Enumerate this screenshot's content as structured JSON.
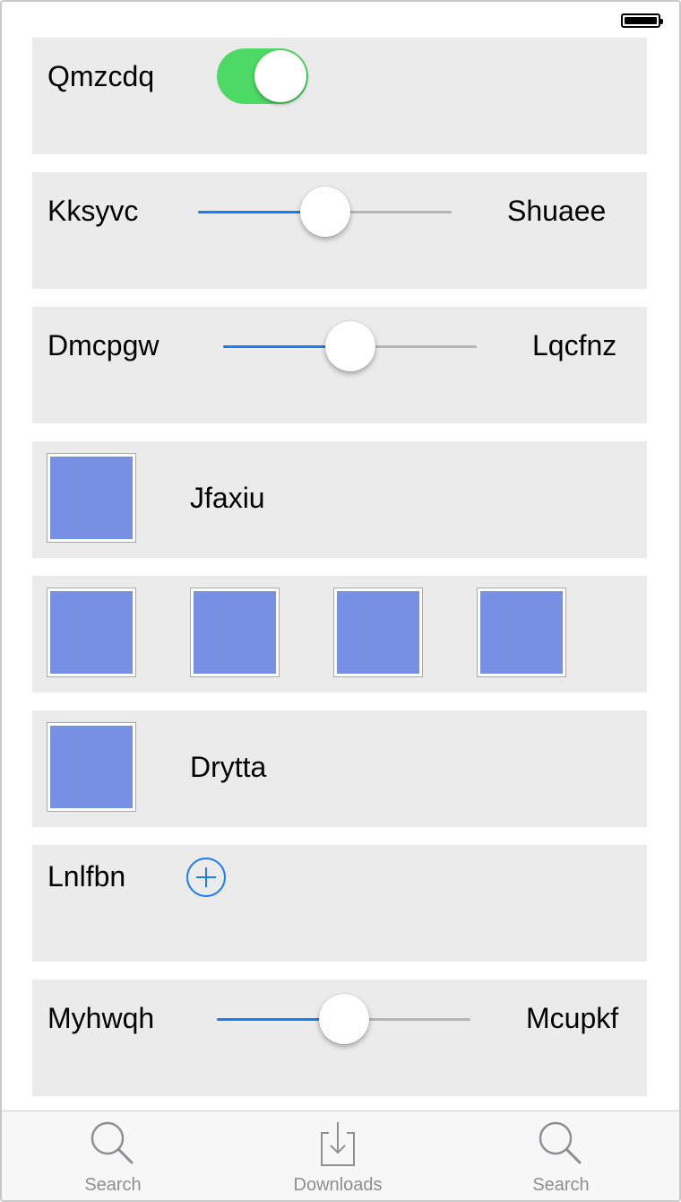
{
  "status_bar": {
    "battery_level": 1.0
  },
  "rows": {
    "toggle_row": {
      "label": "Qmzcdq",
      "toggle_on": true
    },
    "slider_row_1": {
      "min_label": "Kksyvc",
      "max_label": "Shuaee",
      "value": 0.5
    },
    "slider_row_2": {
      "min_label": "Dmcpgw",
      "max_label": "Lqcfnz",
      "value": 0.5
    },
    "image_row_1": {
      "label": "Jfaxiu"
    },
    "image_grid_row": {
      "count": 4
    },
    "image_row_2": {
      "label": "Drytta"
    },
    "add_row": {
      "label": "Lnlfbn"
    },
    "slider_row_3": {
      "min_label": "Myhwqh",
      "max_label": "Mcupkf",
      "value": 0.5
    }
  },
  "tab_bar": {
    "tabs": [
      {
        "label": "Search",
        "icon": "search-icon"
      },
      {
        "label": "Downloads",
        "icon": "downloads-icon"
      },
      {
        "label": "Search",
        "icon": "search-icon"
      }
    ]
  },
  "colors": {
    "toggle_on": "#4cd964",
    "slider_fill": "#1a7cf5",
    "image_placeholder": "#7890e4",
    "card_background": "#ebebeb",
    "tab_label": "#8e8e93"
  }
}
